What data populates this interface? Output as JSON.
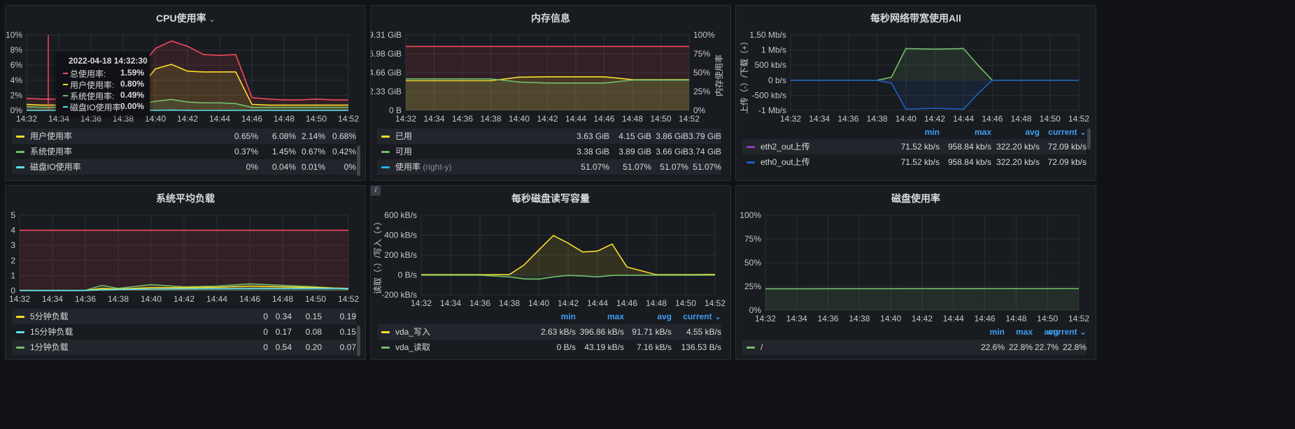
{
  "time_ticks": [
    "14:32",
    "14:34",
    "14:36",
    "14:38",
    "14:40",
    "14:42",
    "14:44",
    "14:46",
    "14:48",
    "14:50",
    "14:52"
  ],
  "panels": {
    "cpu": {
      "title": "CPU使用率",
      "y_ticks": [
        "0%",
        "2%",
        "4%",
        "6%",
        "8%",
        "10%"
      ],
      "tooltip": {
        "time": "2022-04-18 14:32:30",
        "rows": [
          {
            "name": "总使用率:",
            "value": "1.59%",
            "color": "#f2495c"
          },
          {
            "name": "用户使用率:",
            "value": "0.80%",
            "color": "#fade2a"
          },
          {
            "name": "系统使用率:",
            "value": "0.49%",
            "color": "#73bf69"
          },
          {
            "name": "磁盘IO使用率:",
            "value": "0.00%",
            "color": "#5ee0f0"
          }
        ]
      },
      "legend": [
        {
          "name": "用户使用率",
          "color": "#fade2a",
          "values": [
            "0.65%",
            "6.08%",
            "2.14%",
            "0.68%"
          ]
        },
        {
          "name": "系统使用率",
          "color": "#73bf69",
          "values": [
            "0.37%",
            "1.45%",
            "0.67%",
            "0.42%"
          ]
        },
        {
          "name": "磁盘IO使用率",
          "color": "#5ee0f0",
          "values": [
            "0%",
            "0.04%",
            "0.01%",
            "0%"
          ]
        }
      ]
    },
    "mem": {
      "title": "内存信息",
      "y_ticks_left": [
        "0 B",
        "2.33 GiB",
        "4.66 GiB",
        "6.98 GiB",
        "9.31 GiB"
      ],
      "y_ticks_right": [
        "0%",
        "25%",
        "50%",
        "75%",
        "100%"
      ],
      "right_axis_label": "内存使用率",
      "legend": [
        {
          "name": "已用",
          "suffix": "",
          "color": "#fade2a",
          "values": [
            "3.63 GiB",
            "4.15 GiB",
            "3.86 GiB",
            "3.79 GiB"
          ]
        },
        {
          "name": "可用",
          "suffix": "",
          "color": "#73bf69",
          "values": [
            "3.38 GiB",
            "3.89 GiB",
            "3.66 GiB",
            "3.74 GiB"
          ]
        },
        {
          "name": "使用率",
          "suffix": "(right-y)",
          "color": "#1fb4e8",
          "values": [
            "51.07%",
            "51.07%",
            "51.07%",
            "51.07%"
          ]
        }
      ]
    },
    "net": {
      "title": "每秒网络带宽使用All",
      "y_ticks": [
        "-1 Mb/s",
        "-500 kb/s",
        "0 b/s",
        "500 kb/s",
        "1 Mb/s",
        "1.50 Mb/s"
      ],
      "y_axis_label": "上传（-）/下载（+）",
      "legend_heads": [
        "min",
        "max",
        "avg",
        "current"
      ],
      "legend": [
        {
          "name": "eth2_out上传",
          "color": "#8f3bb8",
          "values": [
            "71.52 kb/s",
            "958.84 kb/s",
            "322.20 kb/s",
            "72.09 kb/s"
          ]
        },
        {
          "name": "eth0_out上传",
          "color": "#1f60c4",
          "values": [
            "71.52 kb/s",
            "958.84 kb/s",
            "322.20 kb/s",
            "72.09 kb/s"
          ]
        }
      ]
    },
    "load": {
      "title": "系统平均负载",
      "y_ticks": [
        "0",
        "1",
        "2",
        "3",
        "4",
        "5"
      ],
      "legend": [
        {
          "name": "5分钟负载",
          "color": "#fade2a",
          "values": [
            "0",
            "0.34",
            "0.15",
            "0.19"
          ]
        },
        {
          "name": "15分钟负载",
          "color": "#5ee0f0",
          "values": [
            "0",
            "0.17",
            "0.08",
            "0.15"
          ]
        },
        {
          "name": "1分钟负载",
          "color": "#73bf69",
          "values": [
            "0",
            "0.54",
            "0.20",
            "0.07"
          ]
        }
      ]
    },
    "disk_io": {
      "title": "每秒磁盘读写容量",
      "info": "i",
      "y_ticks": [
        "-200 kB/s",
        "0 B/s",
        "200 kB/s",
        "400 kB/s",
        "600 kB/s"
      ],
      "y_axis_label": "读取（-）/写入（+）",
      "legend_heads": [
        "min",
        "max",
        "avg",
        "current"
      ],
      "legend": [
        {
          "name": "vda_写入",
          "color": "#fade2a",
          "values": [
            "2.63 kB/s",
            "396.86 kB/s",
            "91.71 kB/s",
            "4.55 kB/s"
          ]
        },
        {
          "name": "vda_读取",
          "color": "#73bf69",
          "values": [
            "0 B/s",
            "43.19 kB/s",
            "7.16 kB/s",
            "136.53 B/s"
          ]
        }
      ]
    },
    "disk_usage": {
      "title": "磁盘使用率",
      "y_ticks": [
        "0%",
        "25%",
        "50%",
        "75%",
        "100%"
      ],
      "legend_heads": [
        "min",
        "max",
        "avg",
        "current"
      ],
      "legend": [
        {
          "name": "/",
          "color": "#73bf69",
          "values": [
            "22.6%",
            "22.8%",
            "22.7%",
            "22.8%"
          ]
        }
      ]
    }
  },
  "chart_data": [
    {
      "type": "line",
      "title": "CPU使用率",
      "ylim": [
        0,
        10
      ],
      "x": [
        "14:32",
        "14:33",
        "14:34",
        "14:35",
        "14:36",
        "14:37",
        "14:38",
        "14:39",
        "14:40",
        "14:41",
        "14:42",
        "14:43",
        "14:44",
        "14:45",
        "14:46",
        "14:47",
        "14:48",
        "14:49",
        "14:50",
        "14:51",
        "14:52"
      ],
      "series": [
        {
          "color": "#f2495c",
          "values": [
            1.6,
            1.5,
            1.5,
            1.5,
            1.5,
            1.6,
            1.6,
            5.5,
            8.2,
            9.2,
            8.5,
            7.4,
            7.3,
            7.4,
            1.7,
            1.5,
            1.4,
            1.4,
            1.5,
            1.4,
            1.4
          ]
        },
        {
          "name": "用户使用率",
          "color": "#fade2a",
          "values": [
            0.8,
            0.7,
            0.7,
            0.7,
            0.7,
            0.7,
            0.7,
            2.8,
            5.5,
            6.1,
            5.2,
            5.1,
            5.1,
            5.1,
            0.8,
            0.7,
            0.7,
            0.7,
            0.7,
            0.7,
            0.7
          ]
        },
        {
          "name": "系统使用率",
          "color": "#73bf69",
          "values": [
            0.5,
            0.4,
            0.4,
            0.4,
            0.4,
            0.4,
            0.4,
            0.8,
            1.2,
            1.45,
            1.1,
            1.0,
            1.0,
            0.9,
            0.4,
            0.4,
            0.4,
            0.4,
            0.4,
            0.4,
            0.4
          ]
        },
        {
          "name": "磁盘IO使用率",
          "color": "#5ee0f0",
          "values": [
            0,
            0,
            0,
            0,
            0,
            0,
            0,
            0,
            0,
            0.04,
            0,
            0,
            0,
            0,
            0,
            0,
            0,
            0,
            0,
            0,
            0
          ]
        }
      ]
    },
    {
      "type": "line",
      "title": "内存信息",
      "ylim": [
        0,
        9.31
      ],
      "x": [
        "14:32",
        "14:34",
        "14:36",
        "14:38",
        "14:40",
        "14:42",
        "14:44",
        "14:46",
        "14:48",
        "14:50",
        "14:52"
      ],
      "series": [
        {
          "name": "使用率",
          "color": "#f2495c",
          "values": [
            7.9,
            7.9,
            7.9,
            7.9,
            7.9,
            7.9,
            7.9,
            7.9,
            7.9,
            7.9,
            7.9
          ]
        },
        {
          "name": "已用",
          "color": "#fade2a",
          "values": [
            3.66,
            3.66,
            3.66,
            3.66,
            4.1,
            4.15,
            4.15,
            4.15,
            3.79,
            3.79,
            3.79
          ]
        },
        {
          "name": "可用",
          "color": "#73bf69",
          "values": [
            3.89,
            3.89,
            3.89,
            3.89,
            3.5,
            3.38,
            3.38,
            3.38,
            3.74,
            3.74,
            3.74
          ]
        }
      ]
    },
    {
      "type": "area",
      "title": "每秒网络带宽使用All",
      "ylim": [
        -1,
        1.5
      ],
      "x": [
        "14:32",
        "14:34",
        "14:36",
        "14:38",
        "14:39",
        "14:40",
        "14:42",
        "14:44",
        "14:45",
        "14:46",
        "14:48",
        "14:50",
        "14:52"
      ],
      "series": [
        {
          "color": "#73bf69",
          "values": [
            0,
            0,
            0,
            0,
            0.1,
            1.05,
            1.03,
            1.05,
            0.5,
            0,
            0,
            0,
            0
          ]
        },
        {
          "name": "eth0_out上传",
          "color": "#1f60c4",
          "values": [
            0,
            0,
            0,
            0,
            -0.1,
            -0.96,
            -0.93,
            -0.96,
            -0.45,
            0,
            0,
            0,
            0
          ]
        }
      ]
    },
    {
      "type": "line",
      "title": "系统平均负载",
      "ylim": [
        0,
        5
      ],
      "x": [
        "14:32",
        "14:34",
        "14:36",
        "14:37",
        "14:38",
        "14:40",
        "14:42",
        "14:44",
        "14:46",
        "14:48",
        "14:50",
        "14:52"
      ],
      "series": [
        {
          "color": "#f2495c",
          "values": [
            4,
            4,
            4,
            4,
            4,
            4,
            4,
            4,
            4,
            4,
            4,
            4
          ]
        },
        {
          "name": "1分钟负载",
          "color": "#73bf69",
          "values": [
            0.02,
            0.02,
            0.02,
            0.35,
            0.15,
            0.4,
            0.25,
            0.3,
            0.45,
            0.35,
            0.25,
            0.1
          ]
        },
        {
          "name": "5分钟负载",
          "color": "#fade2a",
          "values": [
            0.01,
            0.01,
            0.01,
            0.15,
            0.1,
            0.2,
            0.2,
            0.22,
            0.3,
            0.25,
            0.2,
            0.15
          ]
        },
        {
          "name": "15分钟负载",
          "color": "#5ee0f0",
          "values": [
            0.01,
            0.01,
            0.01,
            0.05,
            0.08,
            0.1,
            0.12,
            0.13,
            0.15,
            0.15,
            0.15,
            0.15
          ]
        }
      ]
    },
    {
      "type": "area",
      "title": "每秒磁盘读写容量",
      "ylim": [
        -200,
        600
      ],
      "x": [
        "14:32",
        "14:34",
        "14:36",
        "14:38",
        "14:39",
        "14:40",
        "14:41",
        "14:42",
        "14:43",
        "14:44",
        "14:45",
        "14:46",
        "14:48",
        "14:50",
        "14:52"
      ],
      "series": [
        {
          "name": "vda_写入",
          "color": "#fade2a",
          "values": [
            3,
            3,
            3,
            3,
            100,
            250,
            396,
            320,
            230,
            240,
            310,
            80,
            3,
            3,
            5
          ]
        },
        {
          "name": "vda_读取",
          "color": "#73bf69",
          "values": [
            -3,
            -3,
            -3,
            -20,
            -40,
            -43,
            -20,
            -5,
            -10,
            -20,
            -5,
            -3,
            -3,
            -3,
            -2
          ]
        }
      ]
    },
    {
      "type": "line",
      "title": "磁盘使用率",
      "ylim": [
        0,
        100
      ],
      "x": [
        "14:32",
        "14:52"
      ],
      "series": [
        {
          "name": "/",
          "color": "#73bf69",
          "values": [
            22.6,
            22.8
          ]
        }
      ]
    }
  ]
}
